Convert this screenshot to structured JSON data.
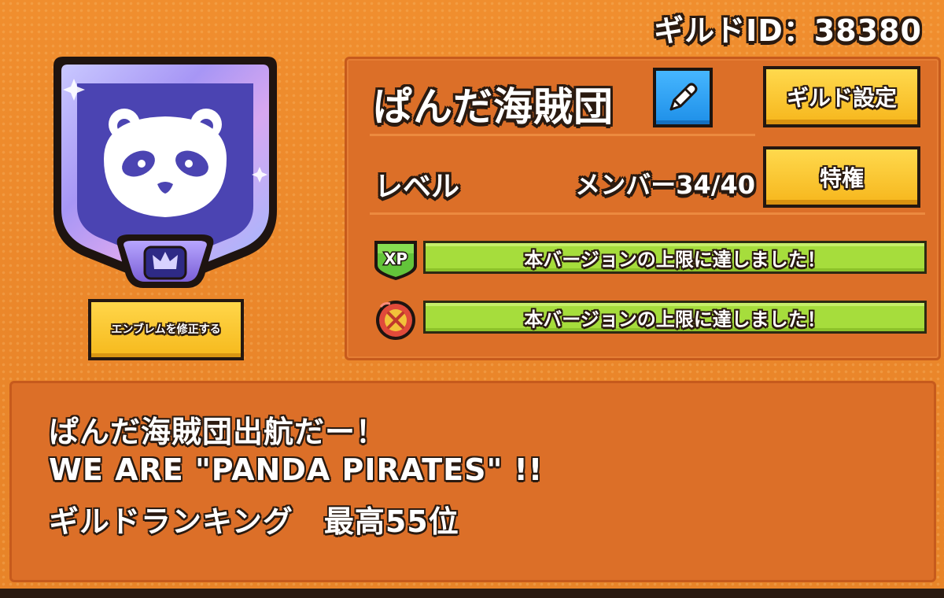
{
  "header": {
    "guild_id_text": "ギルドID：38380"
  },
  "emblem": {
    "edit_button_label": "エンブレムを修正する",
    "icon": "panda-face-icon",
    "badge_icon": "crown-badge-icon"
  },
  "guild": {
    "name": "ぱんだ海賊団",
    "edit_name_icon": "pencil-icon",
    "settings_button_label": "ギルド設定",
    "privilege_button_label": "特権",
    "level_label": "レベル",
    "members_text": "メンバー34/40"
  },
  "caps": [
    {
      "icon": "xp-badge-icon",
      "icon_text": "XP",
      "text": "本バージョンの上限に達しました！"
    },
    {
      "icon": "crossed-swords-medal-icon",
      "text": "本バージョンの上限に達しました！"
    }
  ],
  "description": {
    "lines": [
      "ぱんだ海賊団出航だー！",
      "WE ARE \"PANDA PIRATES\" !!",
      "ギルドランキング　最高55位"
    ]
  },
  "colors": {
    "background": "#ec8a2c",
    "panel": "#dc6f28",
    "button_yellow": "#f6b91c",
    "button_blue": "#1e8fe8",
    "bar_green": "#a6dd3c",
    "emblem_purple": "#4b44b2"
  }
}
